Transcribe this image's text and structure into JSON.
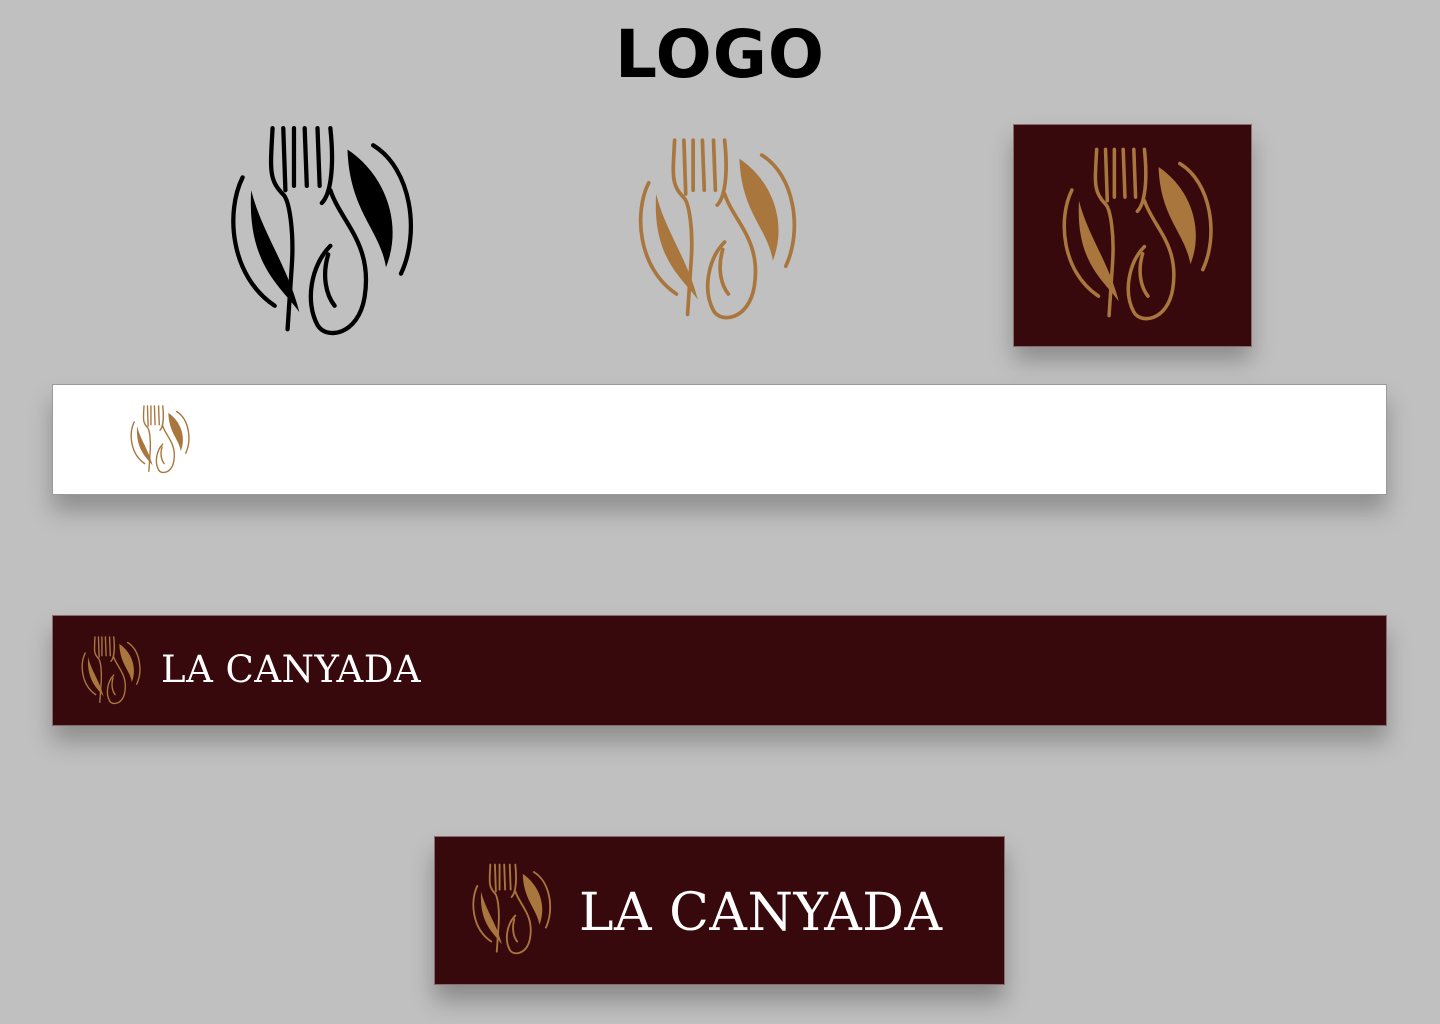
{
  "page": {
    "title": "LOGO",
    "background": "#c0c0c0"
  },
  "brand": {
    "name": "LA CANYADA",
    "colors": {
      "gold": "#a9763d",
      "burgundy": "#37080c",
      "black": "#000000",
      "white": "#ffffff"
    },
    "icon": "fork-and-spoon-icon"
  },
  "variants": [
    {
      "id": "mark-black",
      "background": "transparent",
      "mark_color": "#000000",
      "wordmark": false
    },
    {
      "id": "mark-gold",
      "background": "transparent",
      "mark_color": "#a9763d",
      "wordmark": false
    },
    {
      "id": "mark-on-burgundy-square",
      "background": "#37080c",
      "mark_color": "#a9763d",
      "wordmark": false
    },
    {
      "id": "mark-on-white-banner",
      "background": "#ffffff",
      "mark_color": "#a9763d",
      "wordmark": false
    },
    {
      "id": "logo-on-burgundy-banner",
      "background": "#37080c",
      "mark_color": "#a9763d",
      "wordmark": true
    },
    {
      "id": "logo-on-burgundy-box",
      "background": "#37080c",
      "mark_color": "#a9763d",
      "wordmark": true
    }
  ]
}
